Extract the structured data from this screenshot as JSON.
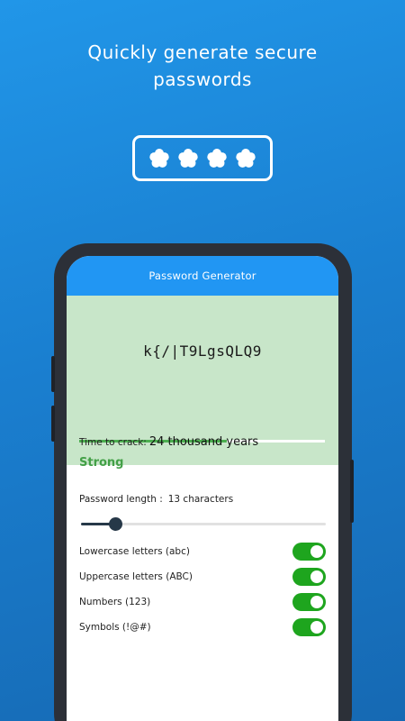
{
  "promo": {
    "headline_line1": "Quickly generate secure",
    "headline_line2": "passwords",
    "badge_icon": "password-asterisks-icon"
  },
  "app": {
    "title": "Password Generator",
    "password": "k{/|T9LgsQLQ9",
    "strength": {
      "label": "Strong",
      "fraction": 0.6
    },
    "crack": {
      "label": "Time to crack:",
      "value": "24 thousand years"
    },
    "length": {
      "label": "Password length :",
      "value_text": "13 characters",
      "fraction": 0.14
    },
    "options": [
      {
        "label": "Lowercase letters (abc)",
        "enabled": true
      },
      {
        "label": "Uppercase letters (ABC)",
        "enabled": true
      },
      {
        "label": "Numbers (123)",
        "enabled": true
      },
      {
        "label": "Symbols (!@#)",
        "enabled": true
      }
    ]
  },
  "colors": {
    "appbar": "#2196f3",
    "result_bg": "#c8e6c9",
    "strength": "#43a047",
    "switch_on": "#1ea51e",
    "slider": "#263848"
  }
}
